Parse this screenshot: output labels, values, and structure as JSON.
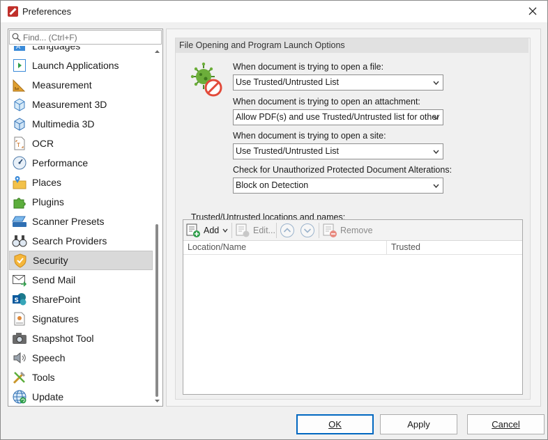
{
  "window": {
    "title": "Preferences"
  },
  "sidebar": {
    "search_placeholder": "Find... (Ctrl+F)",
    "items": [
      {
        "label": "Languages",
        "icon": "languages-icon"
      },
      {
        "label": "Launch Applications",
        "icon": "launch-applications-icon"
      },
      {
        "label": "Measurement",
        "icon": "measurement-icon"
      },
      {
        "label": "Measurement 3D",
        "icon": "measurement-3d-icon"
      },
      {
        "label": "Multimedia 3D",
        "icon": "multimedia-3d-icon"
      },
      {
        "label": "OCR",
        "icon": "ocr-icon"
      },
      {
        "label": "Performance",
        "icon": "performance-icon"
      },
      {
        "label": "Places",
        "icon": "places-icon"
      },
      {
        "label": "Plugins",
        "icon": "plugins-icon"
      },
      {
        "label": "Scanner Presets",
        "icon": "scanner-icon"
      },
      {
        "label": "Search Providers",
        "icon": "binoculars-icon"
      },
      {
        "label": "Security",
        "icon": "shield-icon",
        "selected": true
      },
      {
        "label": "Send Mail",
        "icon": "mail-icon"
      },
      {
        "label": "SharePoint",
        "icon": "sharepoint-icon"
      },
      {
        "label": "Signatures",
        "icon": "signatures-icon"
      },
      {
        "label": "Snapshot Tool",
        "icon": "camera-icon"
      },
      {
        "label": "Speech",
        "icon": "speaker-icon"
      },
      {
        "label": "Tools",
        "icon": "tools-icon"
      },
      {
        "label": "Update",
        "icon": "globe-update-icon"
      }
    ]
  },
  "main": {
    "group_title": "File Opening and Program Launch Options",
    "fields": [
      {
        "label": "When document is trying to open a file:",
        "value": "Use Trusted/Untrusted List"
      },
      {
        "label": "When document is trying to open an attachment:",
        "value": "Allow PDF(s) and use Trusted/Untrusted list for other"
      },
      {
        "label": "When document is trying to open a site:",
        "value": "Use Trusted/Untrusted List"
      },
      {
        "label": "Check for Unauthorized Protected Document Alterations:",
        "value": "Block on Detection"
      }
    ],
    "trusted_label": "Trusted/Untrusted locations and names:",
    "toolbar": {
      "add": "Add",
      "edit": "Edit...",
      "remove": "Remove"
    },
    "columns": [
      "Location/Name",
      "Trusted"
    ]
  },
  "buttons": {
    "ok": "OK",
    "apply": "Apply",
    "cancel": "Cancel"
  },
  "colors": {
    "accent": "#0067c0",
    "selected_bg": "#d9d9d9"
  }
}
